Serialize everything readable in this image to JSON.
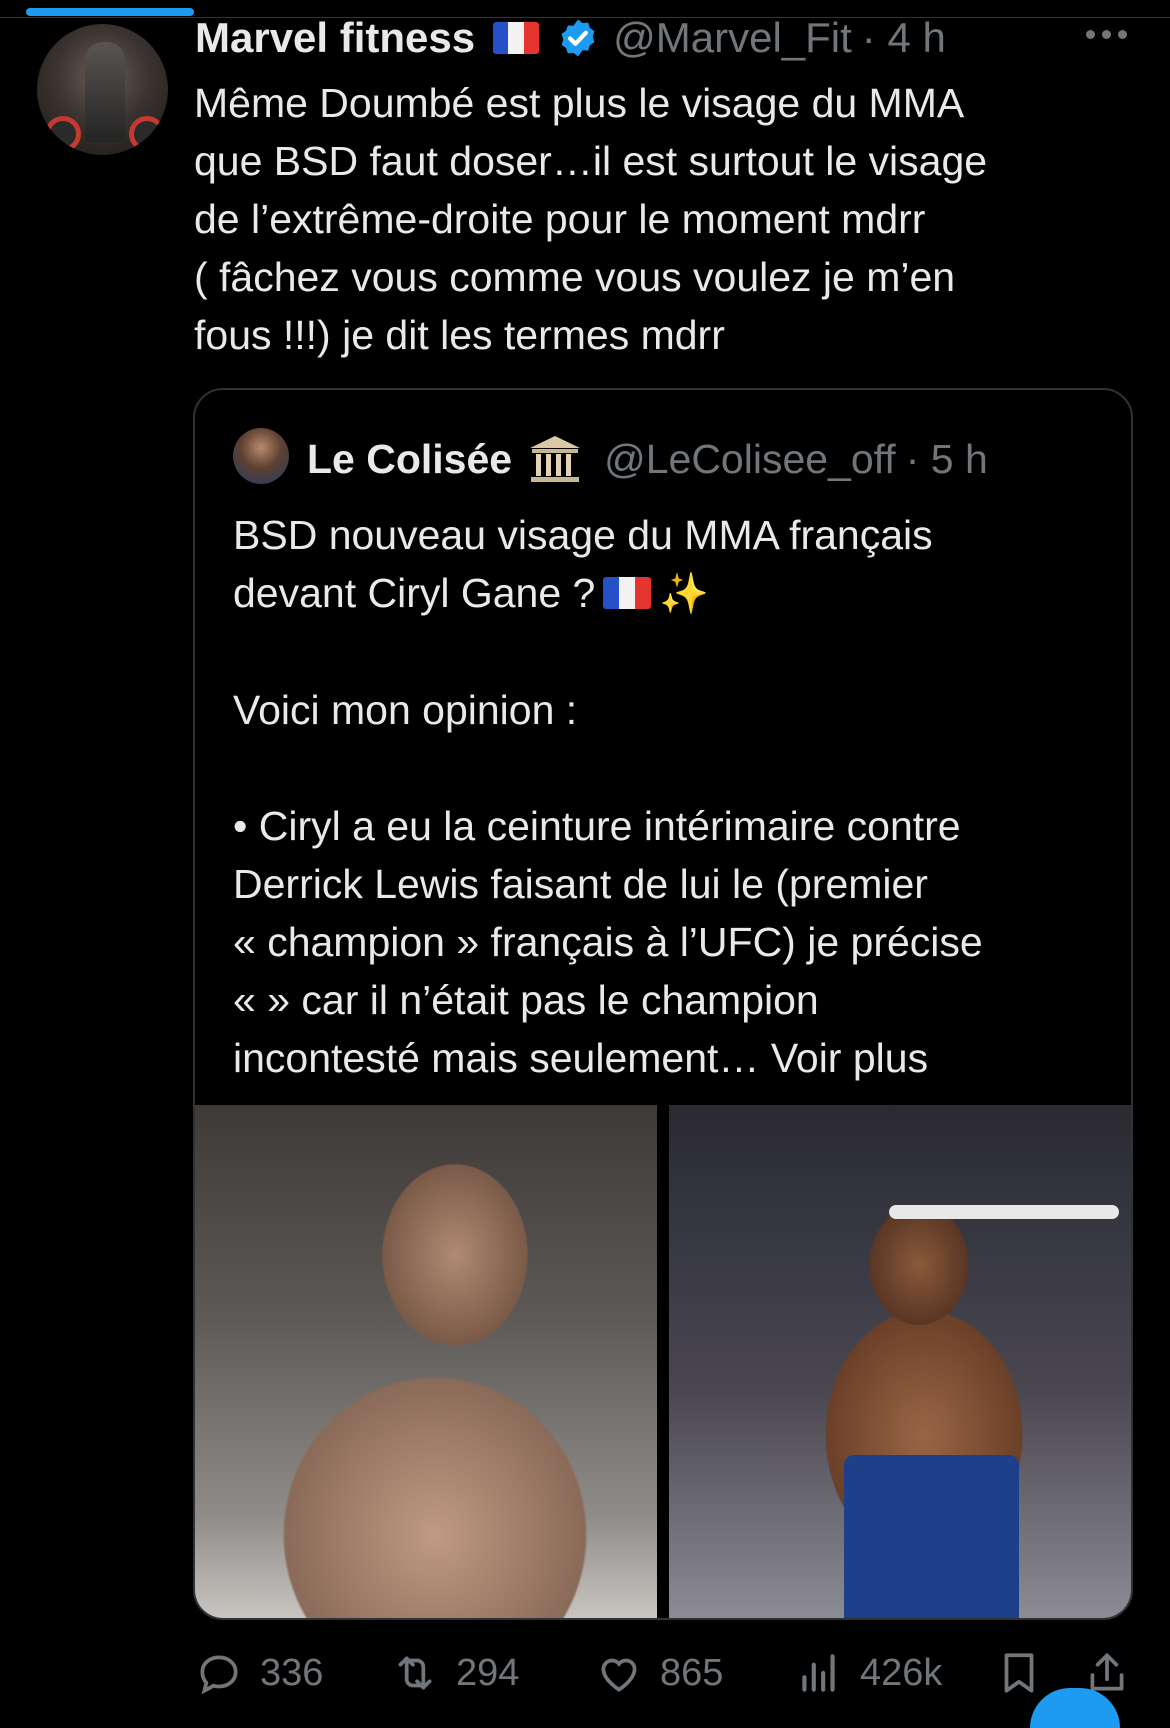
{
  "tweet": {
    "display_name": "Marvel fitness",
    "handle": "@Marvel_Fit",
    "time_meta": "· 4 h",
    "text": "Même Doumbé est plus le visage du MMA\nque BSD faut doser…il est surtout le visage\nde l’extrême-droite pour le moment mdrr\n( fâchez vous comme vous voulez je m’en\nfous !!!) je dit les termes mdrr"
  },
  "quote": {
    "display_name": "Le Colisée",
    "handle": "@LeColisee_off",
    "time_meta": "· 5 h",
    "text_part1": "BSD nouveau visage du MMA français\ndevant Ciryl Gane ?",
    "text_part2": "\n\nVoici mon opinion :\n\n• Ciryl a eu la ceinture intérimaire contre\nDerrick Lewis faisant de lui le (premier\n« champion » français à l’UFC) je précise\n« » car il n’était pas le champion\nincontesté mais seulement…",
    "see_more": " Voir plus"
  },
  "actions": {
    "replies": "336",
    "retweets": "294",
    "likes": "865",
    "views": "426k"
  },
  "colors": {
    "background": "#000000",
    "text": "#e7e9ea",
    "muted": "#71767b",
    "accent": "#1d9bf0"
  },
  "icons": [
    "verified-badge-icon",
    "france-flag-icon",
    "more-icon",
    "classical-building-icon",
    "sparkles-icon",
    "reply-icon",
    "retweet-icon",
    "like-icon",
    "views-icon",
    "bookmark-icon",
    "share-icon"
  ]
}
